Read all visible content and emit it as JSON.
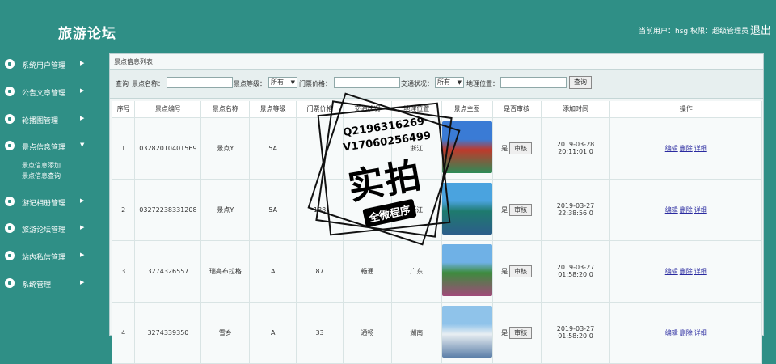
{
  "header": {
    "title": "旅游论坛",
    "user_info": "当前用户：hsg 权限：超级管理员",
    "logout": "退出"
  },
  "sidebar": {
    "items": [
      {
        "label": "系统用户管理",
        "icon": "user-admin-icon"
      },
      {
        "label": "公告文章管理",
        "icon": "article-icon"
      },
      {
        "label": "轮播图管理",
        "icon": "carousel-icon"
      },
      {
        "label": "景点信息管理",
        "icon": "app-icon",
        "expanded": true
      },
      {
        "label": "游记相册管理",
        "icon": "cloud-icon"
      },
      {
        "label": "旅游论坛管理",
        "icon": "forum-icon"
      },
      {
        "label": "站内私信管理",
        "icon": "message-icon"
      },
      {
        "label": "系统管理",
        "icon": "chart-icon"
      }
    ],
    "sub_items": [
      "景点信息添加",
      "景点信息查询"
    ]
  },
  "panel": {
    "title": "景点信息列表"
  },
  "search": {
    "label_query": "查询",
    "label_name": "景点名称：",
    "label_level": "景点等级：",
    "level_value": "所有",
    "label_price": "门票价格：",
    "label_traffic": "交通状况：",
    "traffic_value": "所有",
    "label_location": "地理位置：",
    "button": "查询"
  },
  "table": {
    "headers": [
      "序号",
      "景点编号",
      "景点名称",
      "景点等级",
      "门票价格",
      "交通状况",
      "地理位置",
      "景点主图",
      "是否审核",
      "添加时间",
      "操作"
    ],
    "rows": [
      {
        "no": "1",
        "code": "03282010401569",
        "name": "景点Y",
        "level": "5A",
        "price": "",
        "traffic": "",
        "location": "浙江",
        "audited": "是",
        "audit_btn": "审核",
        "time": "2019-03-28 20:11:01.0",
        "thumb_colors": [
          "#3a7bd5",
          "#c0392b",
          "#2e8b57"
        ]
      },
      {
        "no": "2",
        "code": "03272238331208",
        "name": "景点Y",
        "level": "5A",
        "price": "188",
        "traffic": "",
        "location": "浙江",
        "audited": "是",
        "audit_btn": "审核",
        "time": "2019-03-27 22:38:56.0",
        "thumb_colors": [
          "#4aa3df",
          "#1e7a6e",
          "#2c5e8a"
        ]
      },
      {
        "no": "3",
        "code": "3274326557",
        "name": "瑞亮布拉格",
        "level": "A",
        "price": "87",
        "traffic": "畅通",
        "location": "广东",
        "audited": "是",
        "audit_btn": "审核",
        "time": "2019-03-27 01:58:20.0",
        "thumb_colors": [
          "#6fb1e6",
          "#3d8b3d",
          "#a04a7a"
        ]
      },
      {
        "no": "4",
        "code": "3274339350",
        "name": "雪乡",
        "level": "A",
        "price": "33",
        "traffic": "通畅",
        "location": "湖南",
        "audited": "是",
        "audit_btn": "审核",
        "time": "2019-03-27 01:58:20.0",
        "thumb_colors": [
          "#8fc3ea",
          "#e8eef2",
          "#5c7fa8"
        ]
      }
    ],
    "ops": [
      "编辑",
      "删除",
      "详细"
    ]
  },
  "watermark": {
    "line1": "Q2196316269",
    "line2": "V17060256499",
    "main": "实拍",
    "sub": "全微程序"
  },
  "colors": {
    "primary": "#2f8f86",
    "panel_bg": "#f2f6f6"
  }
}
